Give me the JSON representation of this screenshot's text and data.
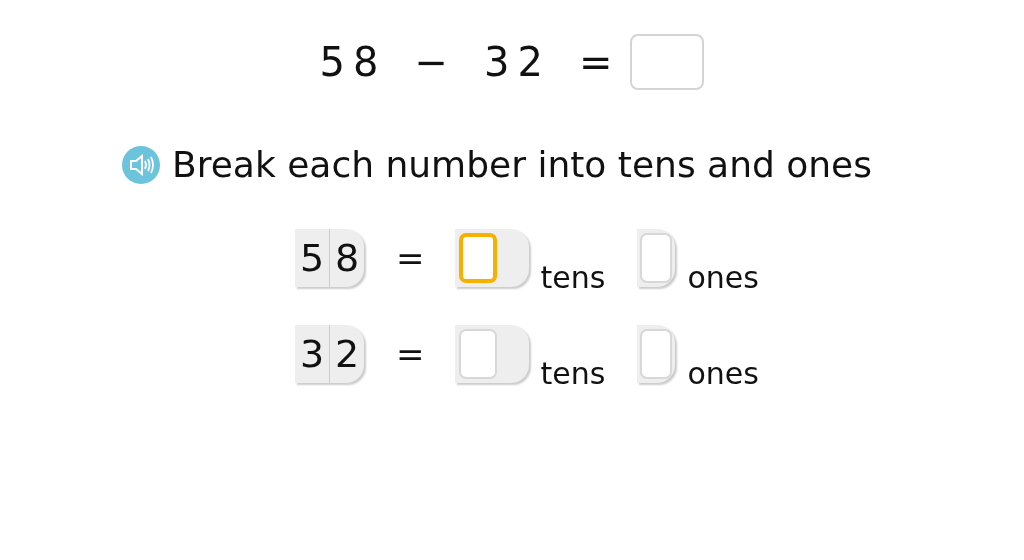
{
  "equation": {
    "terms": [
      "58",
      "−",
      "32",
      "="
    ],
    "answer": {
      "focused": false
    }
  },
  "instruction": {
    "text": "Break each number into tens and ones"
  },
  "rows": [
    {
      "digits": [
        "5",
        "8"
      ],
      "equals": "=",
      "tens_field": {
        "focused": true
      },
      "tens_label": "tens",
      "ones_field": {
        "focused": false
      },
      "ones_label": "ones"
    },
    {
      "digits": [
        "3",
        "2"
      ],
      "equals": "=",
      "tens_field": {
        "focused": false
      },
      "tens_label": "tens",
      "ones_field": {
        "focused": false
      },
      "ones_label": "ones"
    }
  ]
}
